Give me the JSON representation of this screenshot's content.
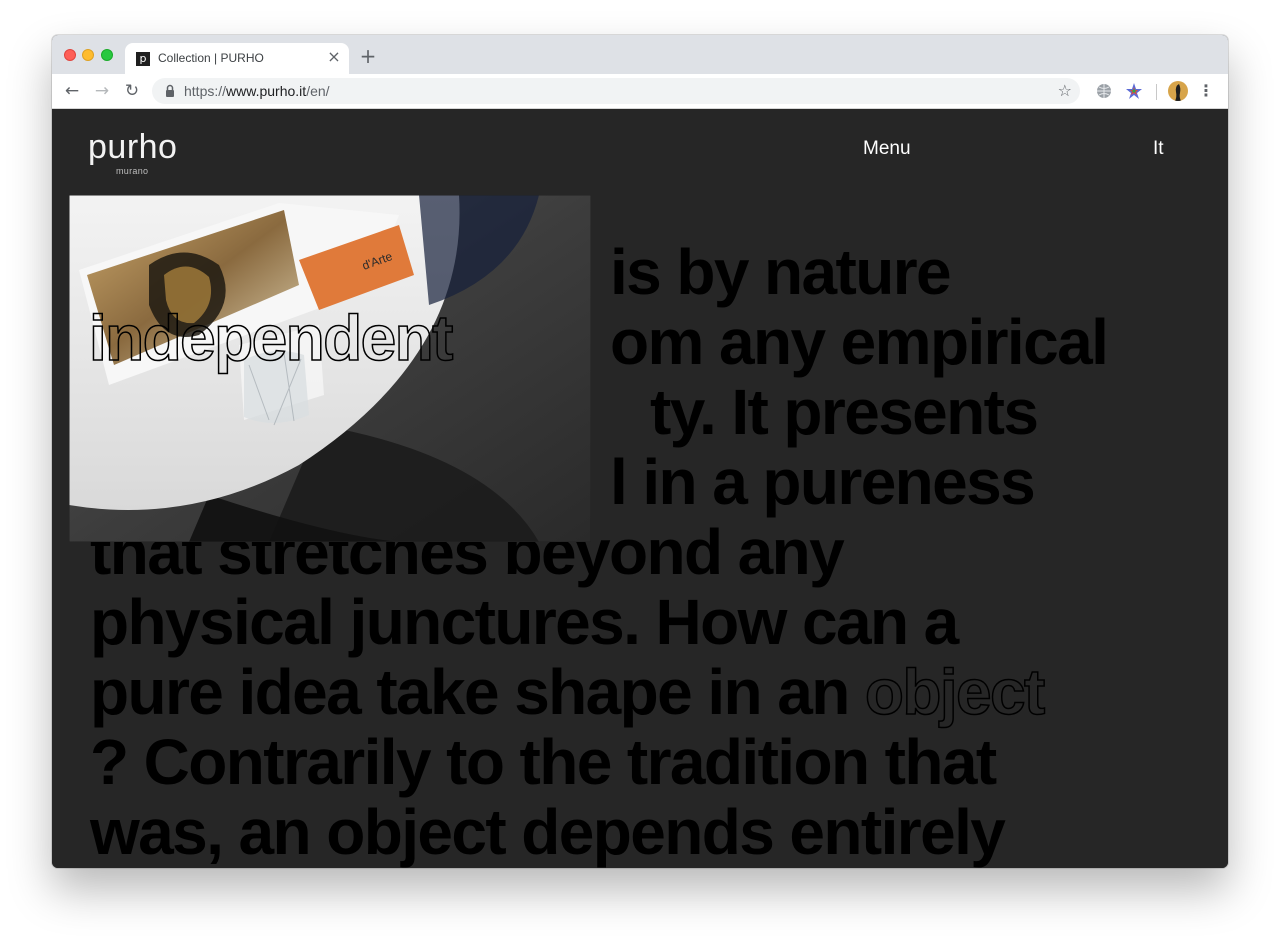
{
  "browser": {
    "tab": {
      "favicon_letter": "p",
      "title": "Collection | PURHO",
      "close_glyph": "×"
    },
    "new_tab_glyph": "+",
    "nav": {
      "back": "←",
      "forward": "→",
      "reload": "↻"
    },
    "url": {
      "scheme": "https://",
      "host": "www.purho.it",
      "path": "/en/"
    },
    "bookmark_glyph": "☆",
    "menu_glyph": "⋮",
    "extensions": [
      "globe-icon",
      "puzzle-star-icon"
    ]
  },
  "site": {
    "logo": {
      "main": "purho",
      "sub": "murano"
    },
    "menu_label": "Menu",
    "lang_label": "It",
    "manifesto": {
      "line1": "is by nature",
      "line2": "om any empirical",
      "line3": "ty. It presents",
      "line4": "l in a pureness",
      "line5": "that stretches beyond any",
      "line6": "physical junctures. How can a",
      "line7_plain": "pure idea take shape in an ",
      "line7_outline": "object",
      "line8": "? Contrarily to the tradition that",
      "line9": "was, an object depends entirely"
    },
    "photo": {
      "outlined_word": "independent",
      "book_label": "d'Arte"
    }
  },
  "colors": {
    "page_bg": "#262626",
    "text_dark": "#000000",
    "nav_text": "#ffffff"
  }
}
